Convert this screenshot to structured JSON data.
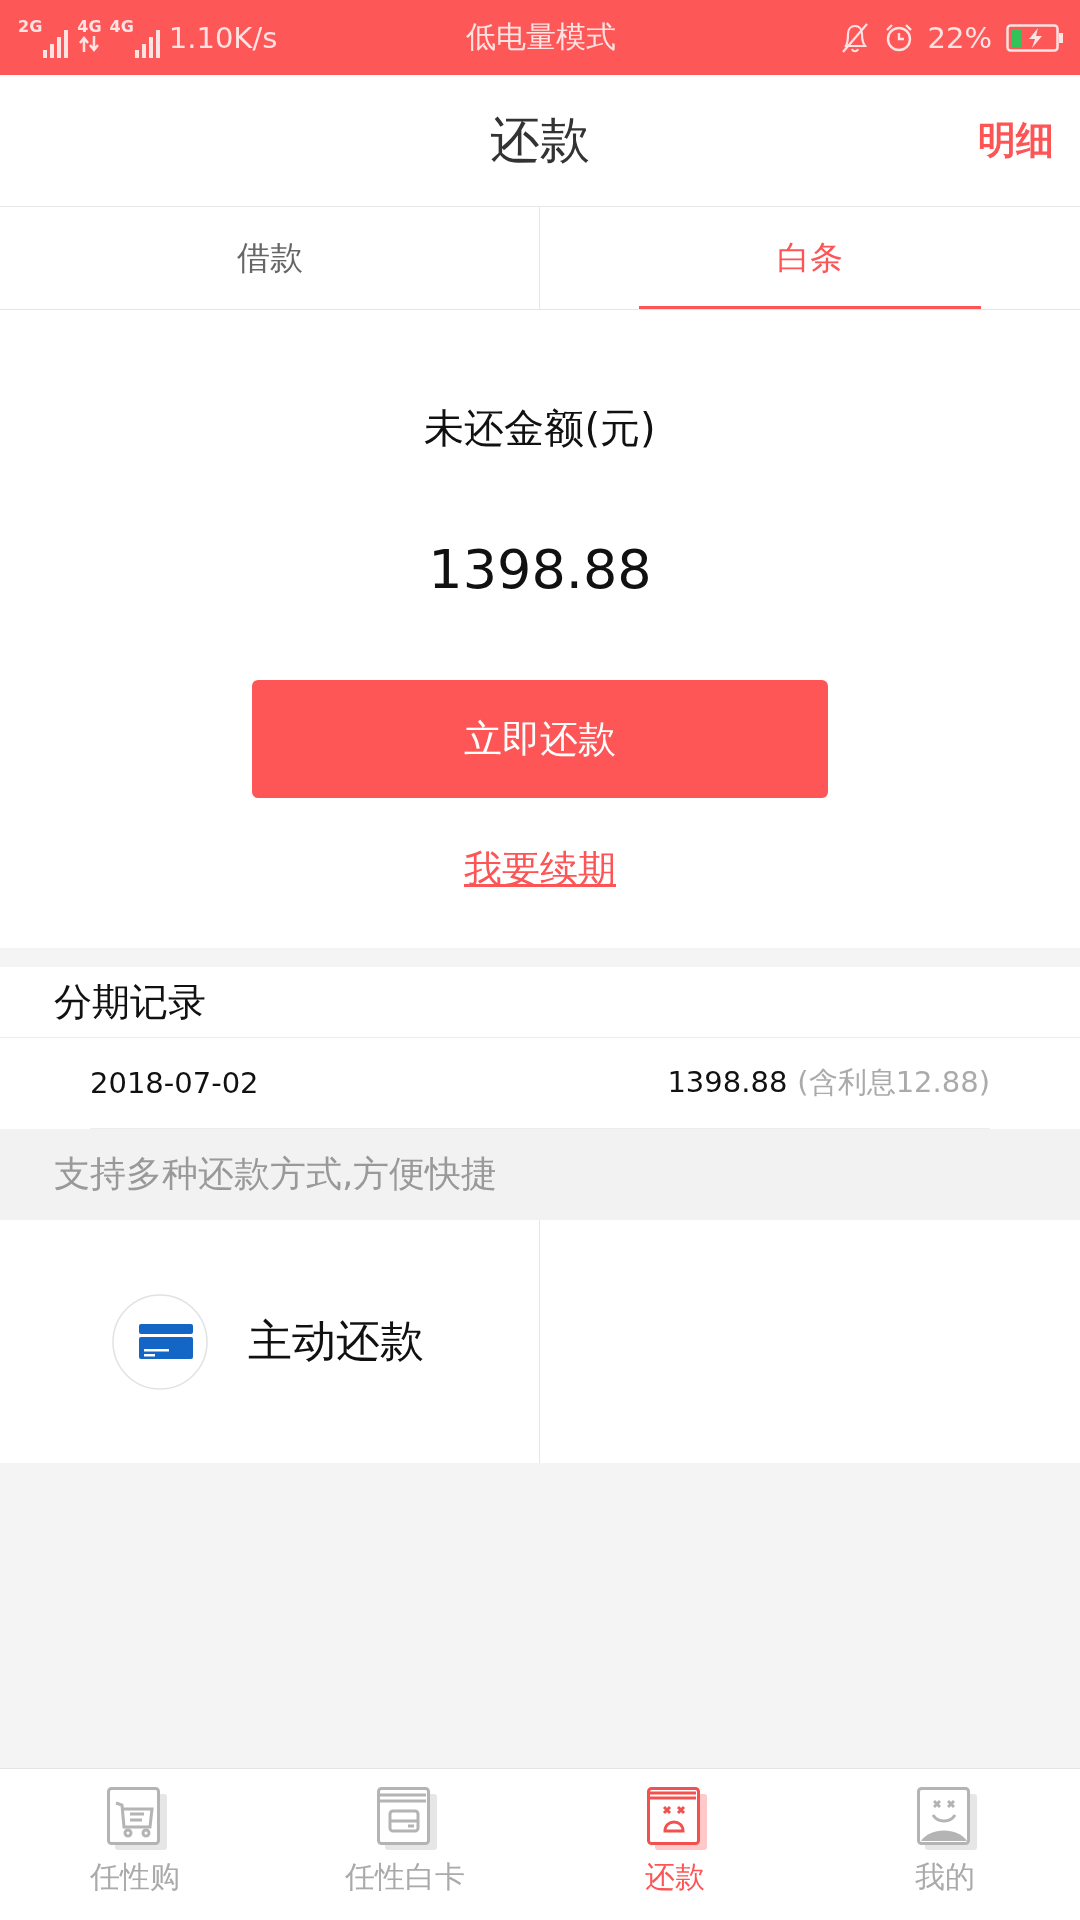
{
  "status_bar": {
    "networks": [
      {
        "label": "2G",
        "kind": "bars"
      },
      {
        "label": "4G",
        "kind": "arrows"
      },
      {
        "label": "4G",
        "kind": "bars"
      }
    ],
    "speed": "1.10K/s",
    "mode": "低电量模式",
    "battery_percent": "22%"
  },
  "header": {
    "title": "还款",
    "action": "明细"
  },
  "tabs": [
    {
      "label": "借款",
      "selected": false
    },
    {
      "label": "白条",
      "selected": true
    }
  ],
  "summary": {
    "label": "未还金额(元)",
    "amount": "1398.88",
    "pay_button": "立即还款",
    "renew_link": "我要续期"
  },
  "installments": {
    "title": "分期记录",
    "rows": [
      {
        "date": "2018-07-02",
        "amount": "1398.88",
        "note": "(含利息12.88)"
      }
    ]
  },
  "notice": "支持多种还款方式,方便快捷",
  "methods": [
    {
      "label": "主动还款"
    }
  ],
  "bottom_nav": [
    {
      "label": "任性购",
      "kind": "cart",
      "selected": false
    },
    {
      "label": "任性白卡",
      "kind": "card",
      "selected": false
    },
    {
      "label": "还款",
      "kind": "sad",
      "selected": true
    },
    {
      "label": "我的",
      "kind": "smile",
      "selected": false
    }
  ]
}
